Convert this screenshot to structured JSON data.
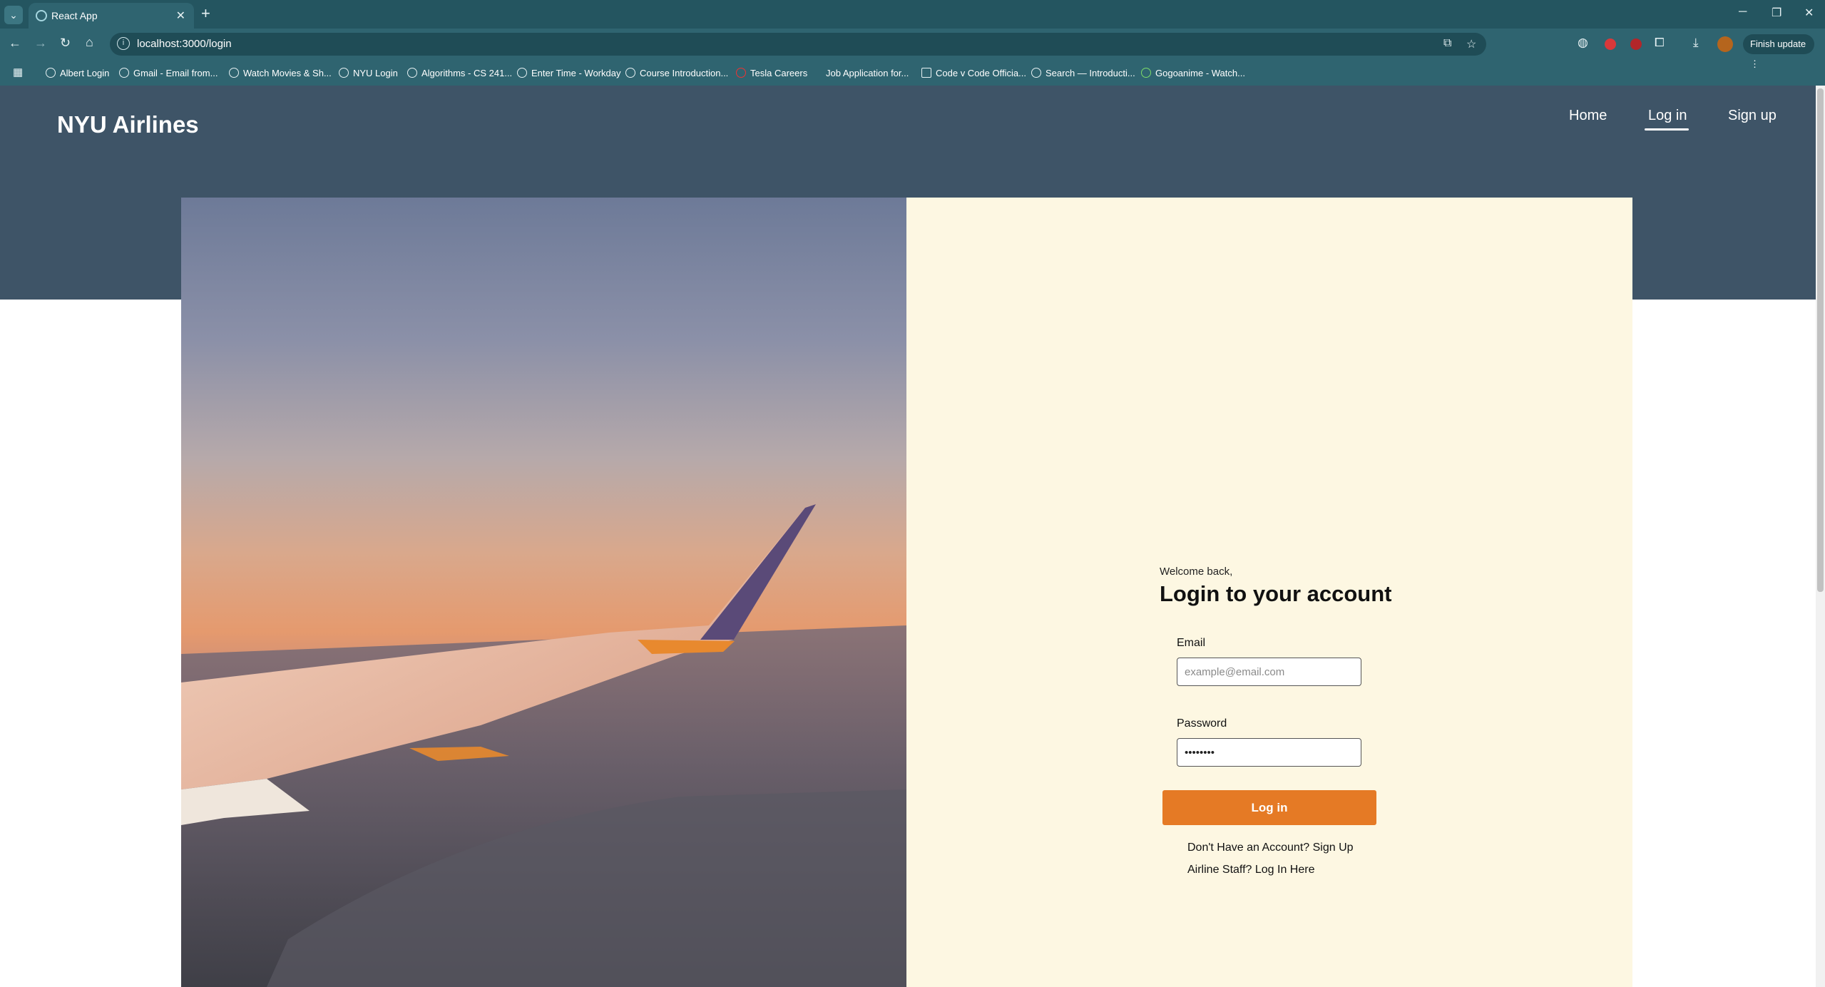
{
  "browser": {
    "tab_title": "React App",
    "url": "localhost:3000/login",
    "finish_update_label": "Finish update",
    "bookmarks": [
      "Albert Login",
      "Gmail - Email from...",
      "Watch Movies & Sh...",
      "NYU Login",
      "Algorithms - CS 241...",
      "Enter Time - Workday",
      "Course Introduction...",
      "Tesla Careers",
      "Job Application for...",
      "Code v Code Officia...",
      "Search — Introducti...",
      "Gogoanime - Watch..."
    ]
  },
  "header": {
    "brand": "NYU Airlines",
    "nav": [
      "Home",
      "Log in",
      "Sign up"
    ],
    "active_nav": "Log in"
  },
  "login": {
    "welcome": "Welcome back,",
    "title": "Login to your account",
    "email_label": "Email",
    "email_placeholder": "example@email.com",
    "password_label": "Password",
    "password_value": "••••••••",
    "submit_label": "Log in",
    "signup_link": "Don't Have an Account? Sign Up",
    "staff_link": "Airline Staff? Log In Here"
  },
  "colors": {
    "header_bg": "#3e5467",
    "panel_bg": "#fdf7e2",
    "button_bg": "#e57a25"
  }
}
